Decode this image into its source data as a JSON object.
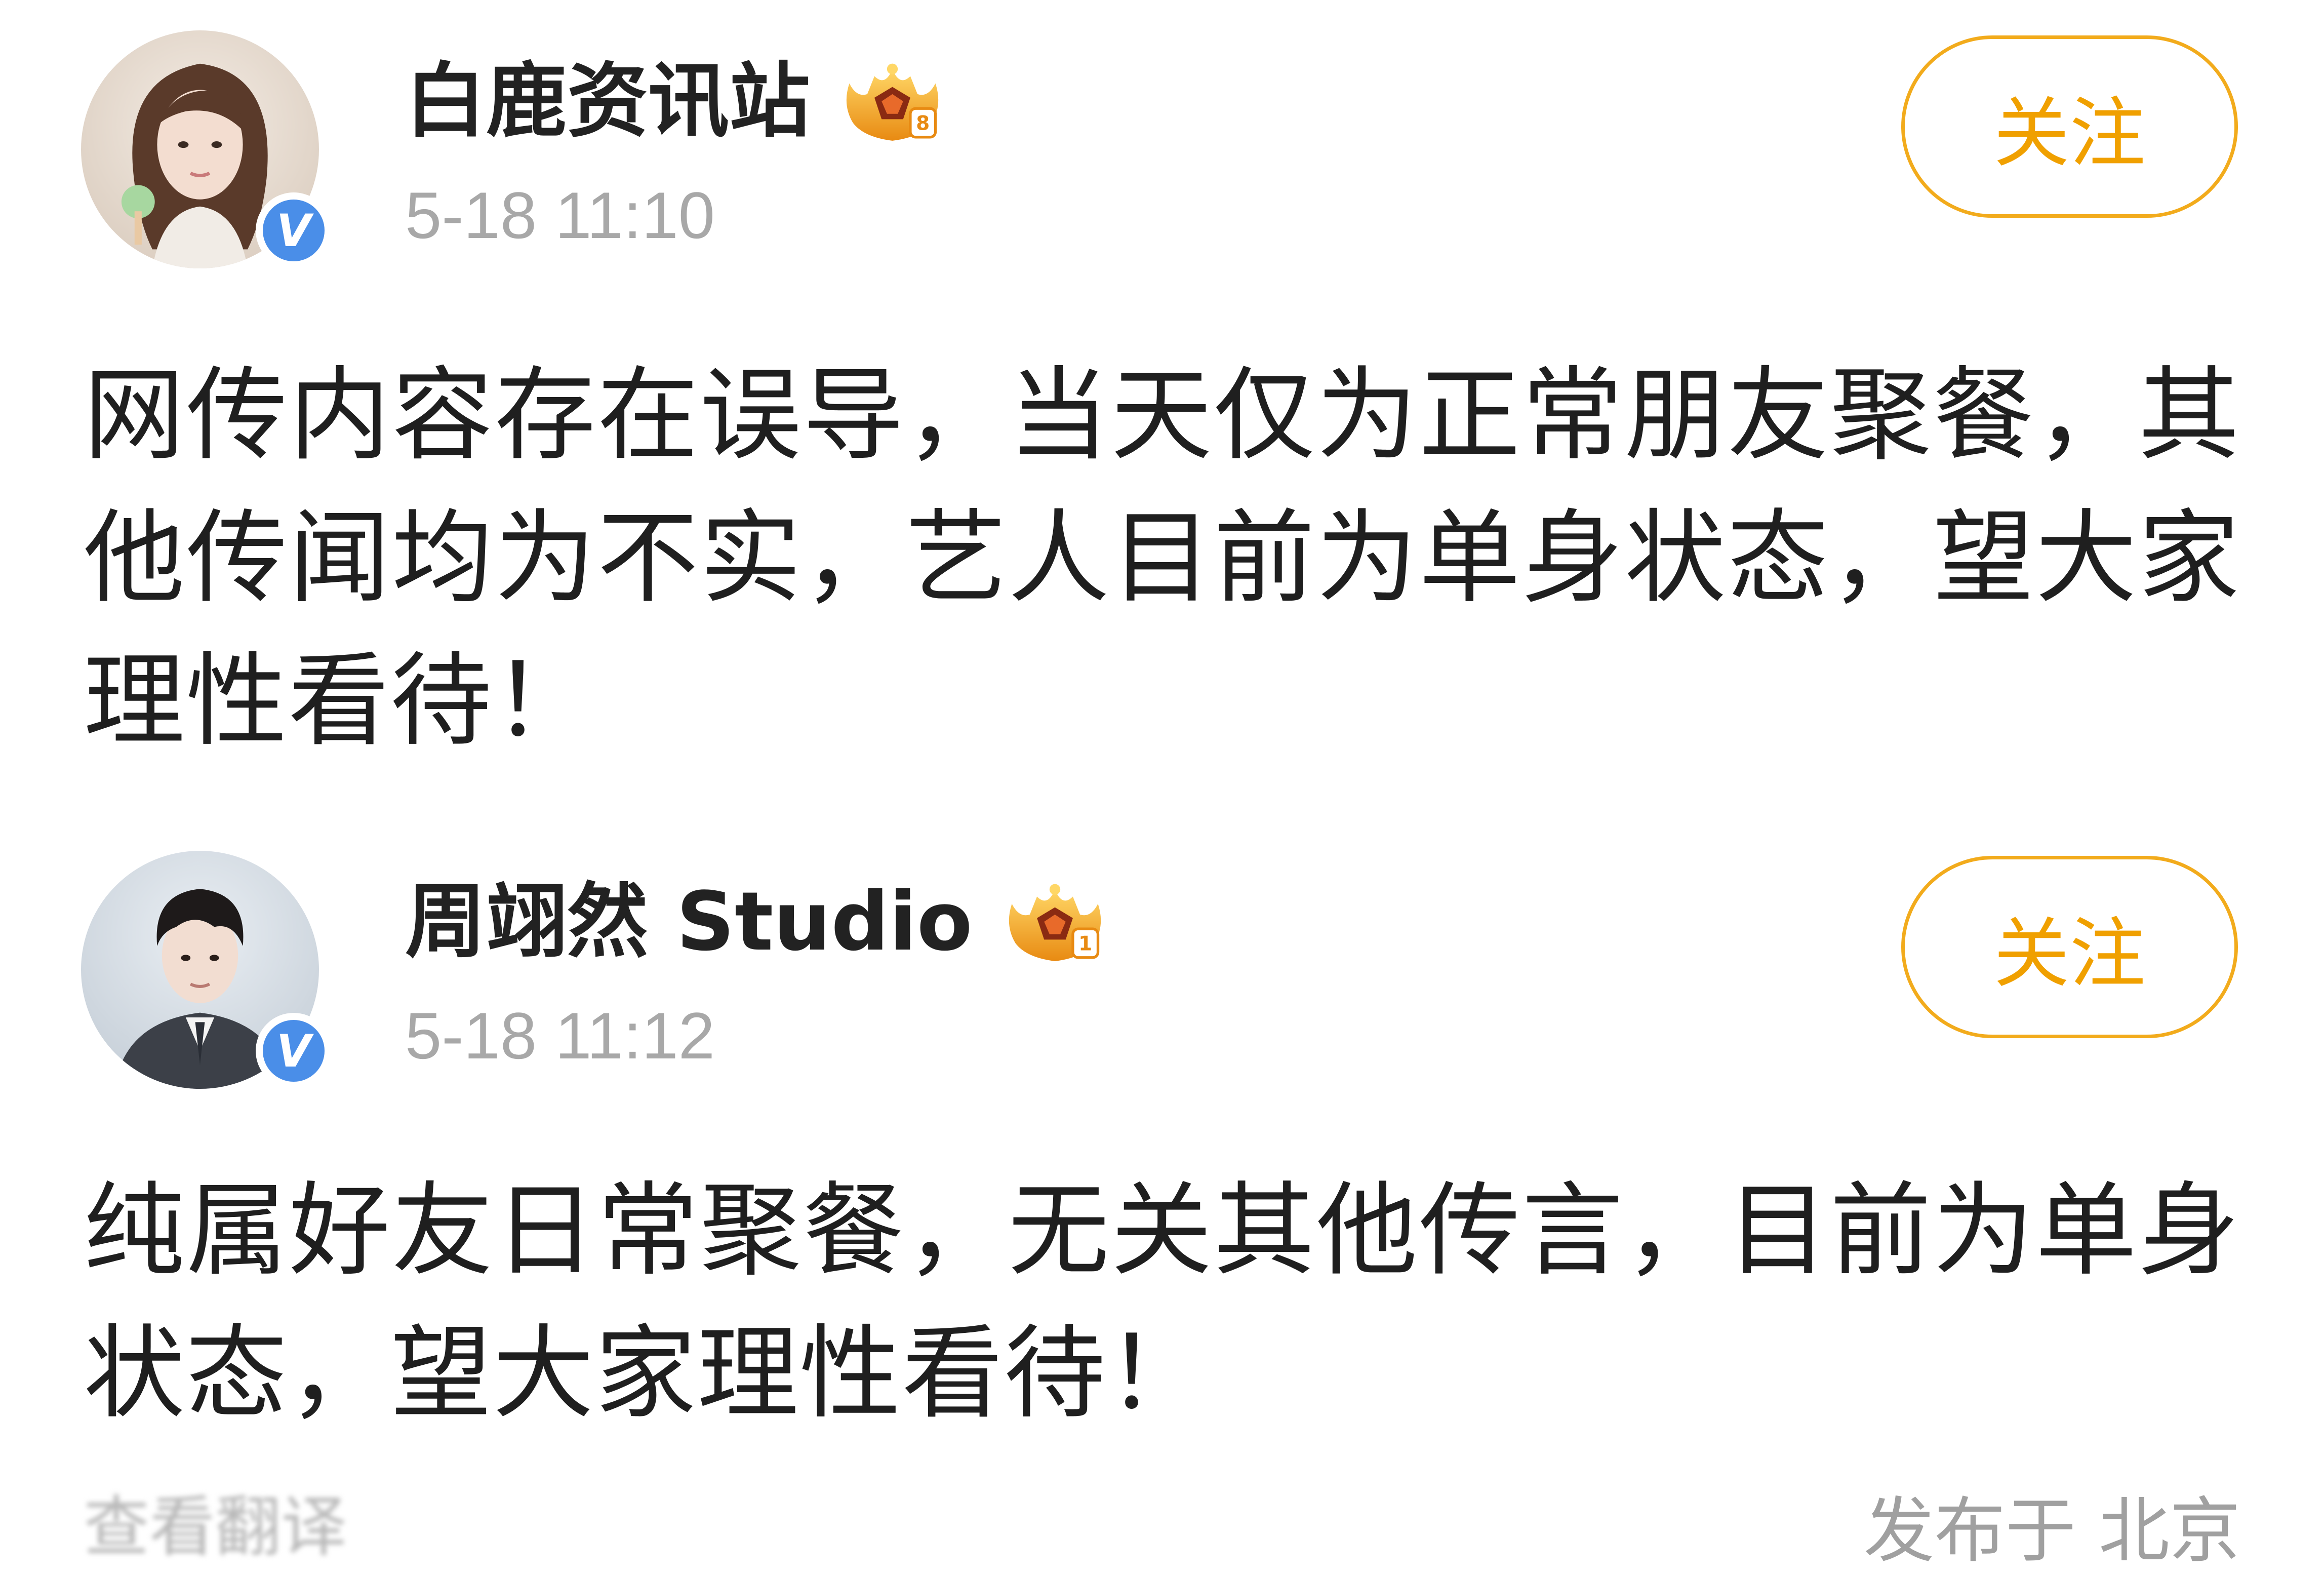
{
  "posts": [
    {
      "username": "白鹿资讯站",
      "timestamp": "5-18 11:10",
      "verified_badge": "V",
      "crown_level": "8",
      "follow_label": "关注",
      "text": "网传内容存在误导，当天仅为正常朋友聚餐，其他传闻均为不实，艺人目前为单身状态，望大家理性看待！",
      "avatar_icon": "female-portrait-avatar"
    },
    {
      "username": "周翊然 Studio",
      "timestamp": "5-18 11:12",
      "verified_badge": "V",
      "crown_level": "1",
      "follow_label": "关注",
      "text": "纯属好友日常聚餐，无关其他传言，目前为单身状态，望大家理性看待！",
      "avatar_icon": "male-portrait-avatar",
      "translate_label": "查看翻译",
      "location_label": "发布于 北京"
    }
  ],
  "colors": {
    "follow_accent": "#f0a000",
    "verified_blue": "#4a8ee8",
    "timestamp_gray": "#a8a8a8"
  }
}
